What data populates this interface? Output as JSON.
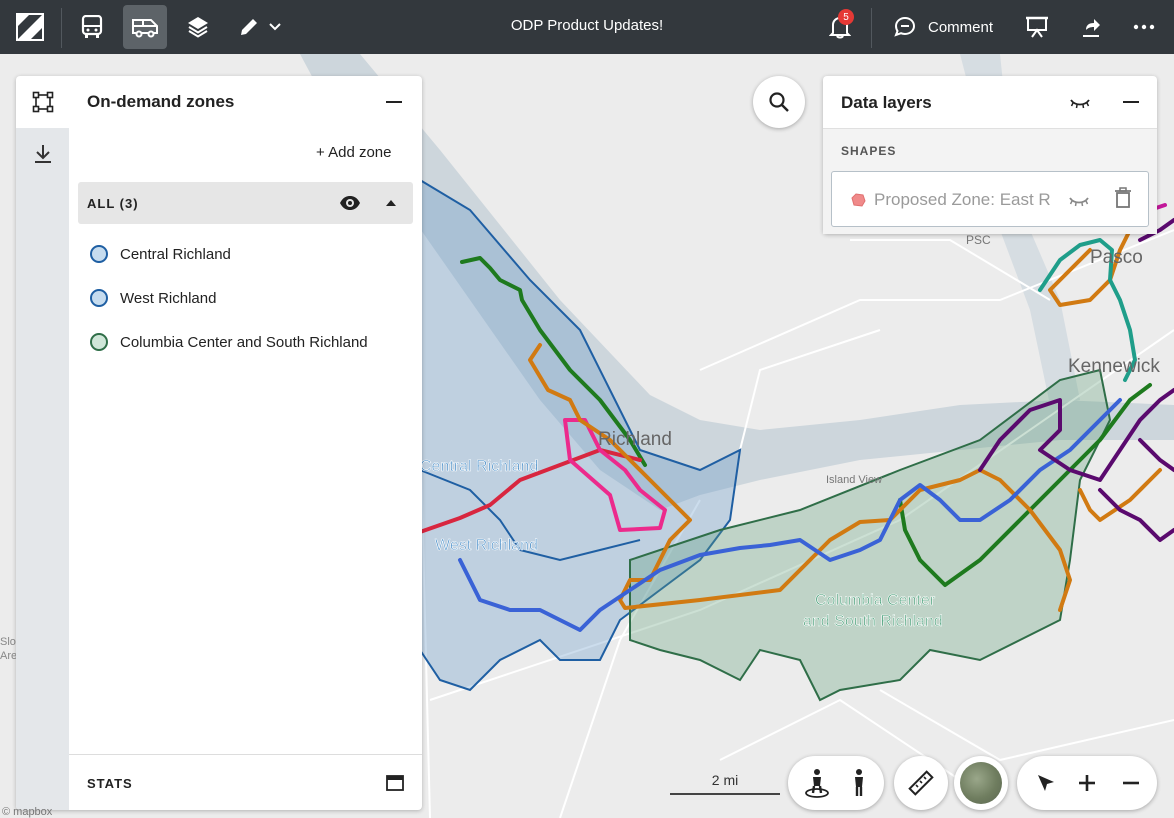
{
  "topbar": {
    "title": "ODP Product Updates!",
    "notifications_count": "5",
    "comment_label": "Comment",
    "icons": [
      "logo-icon",
      "bus-icon",
      "van-icon",
      "layers-icon",
      "pencil-icon",
      "chevron-down-icon",
      "bell-icon",
      "comment-icon",
      "present-icon",
      "share-icon",
      "more-icon"
    ]
  },
  "zones_panel": {
    "title": "On-demand zones",
    "add_zone_label": "+ Add zone",
    "group_label": "ALL (3)",
    "zones": [
      {
        "name": "Central Richland",
        "color": "#1f5fa3",
        "fill": "#c6dcef"
      },
      {
        "name": "West Richland",
        "color": "#1f5fa3",
        "fill": "#c6dcef"
      },
      {
        "name": "Columbia Center and South Richland",
        "color": "#2f6e48",
        "fill": "#cfe6d8"
      }
    ],
    "stats_label": "STATS"
  },
  "layers_panel": {
    "title": "Data layers",
    "section_label": "SHAPES",
    "shape_item_label": "Proposed Zone: East R",
    "shape_swatch_color": "#f08a8a"
  },
  "map": {
    "labels": {
      "richland": "Richland",
      "central_richland": "Central Richland",
      "west_richland": "West Richland",
      "columbia_center_1": "Columbia Center",
      "columbia_center_2": "and South Richland",
      "pasco": "Pasco",
      "kennewick": "Kennewick",
      "island_view": "Island View",
      "psc": "PSC",
      "slo": "Slo",
      "area": "Area"
    },
    "scale_label": "2 mi",
    "attribution": "© mapbox"
  },
  "colors": {
    "topbar": "#33383d",
    "route_green": "#1e7a1e",
    "route_orange": "#d17a12",
    "route_red": "#d8263f",
    "route_pink": "#ec2a8c",
    "route_blue": "#3a62d6",
    "route_purple": "#5a0a6e",
    "route_teal": "#1f9e8a",
    "river": "#cdd6dc"
  }
}
